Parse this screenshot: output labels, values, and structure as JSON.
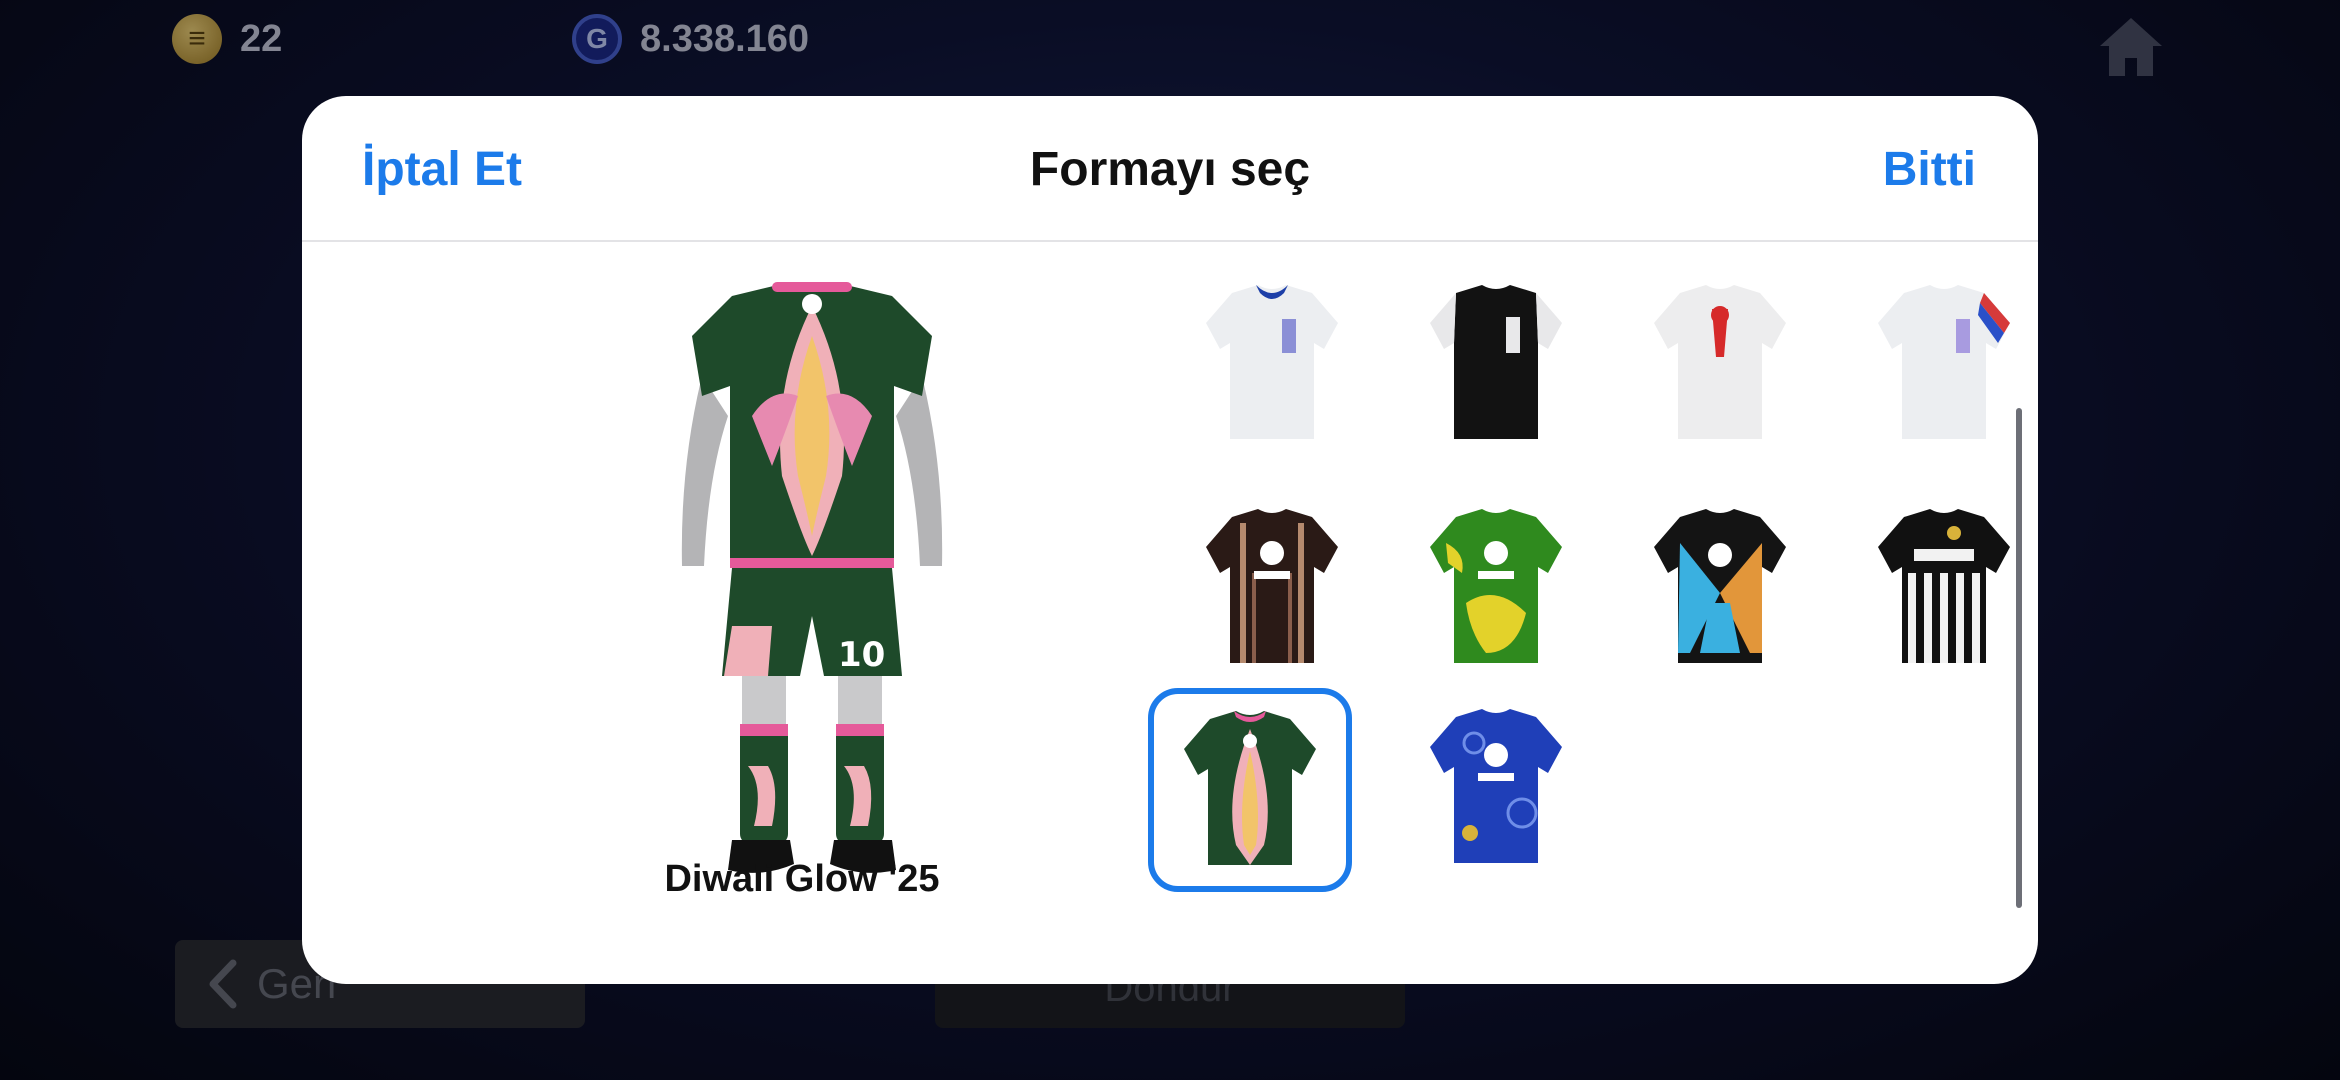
{
  "header": {
    "coins_value": "22",
    "gp_value": "8.338.160",
    "coin_icon": "coin-icon",
    "gp_icon": "gp-icon",
    "gp_glyph": "G",
    "coin_glyph": "≡",
    "home_icon": "home-icon"
  },
  "background_buttons": {
    "back_label": "Geri",
    "done_label": "Dondur"
  },
  "modal": {
    "title": "Formayı seç",
    "cancel_label": "İptal Et",
    "done_label": "Bitti",
    "preview_name": "Diwali Glow '25"
  },
  "kits": [
    {
      "icon": "white-blue-collar-jersey-icon",
      "selected": false
    },
    {
      "icon": "black-white-sleeve-jersey-icon",
      "selected": false
    },
    {
      "icon": "white-red-emblem-jersey-icon",
      "selected": false
    },
    {
      "icon": "white-tricolor-sleeve-jersey-icon",
      "selected": false
    },
    {
      "icon": "brown-pattern-jersey-icon",
      "selected": false
    },
    {
      "icon": "green-yellow-jersey-icon",
      "selected": false
    },
    {
      "icon": "black-multicolor-jersey-icon",
      "selected": false
    },
    {
      "icon": "black-white-stripes-jersey-icon",
      "selected": false
    },
    {
      "icon": "diwali-glow-jersey-icon",
      "selected": true
    },
    {
      "icon": "blue-pattern-jersey-icon",
      "selected": false
    }
  ],
  "colors": {
    "accent": "#1c7bea",
    "modal_bg": "#ffffff"
  }
}
